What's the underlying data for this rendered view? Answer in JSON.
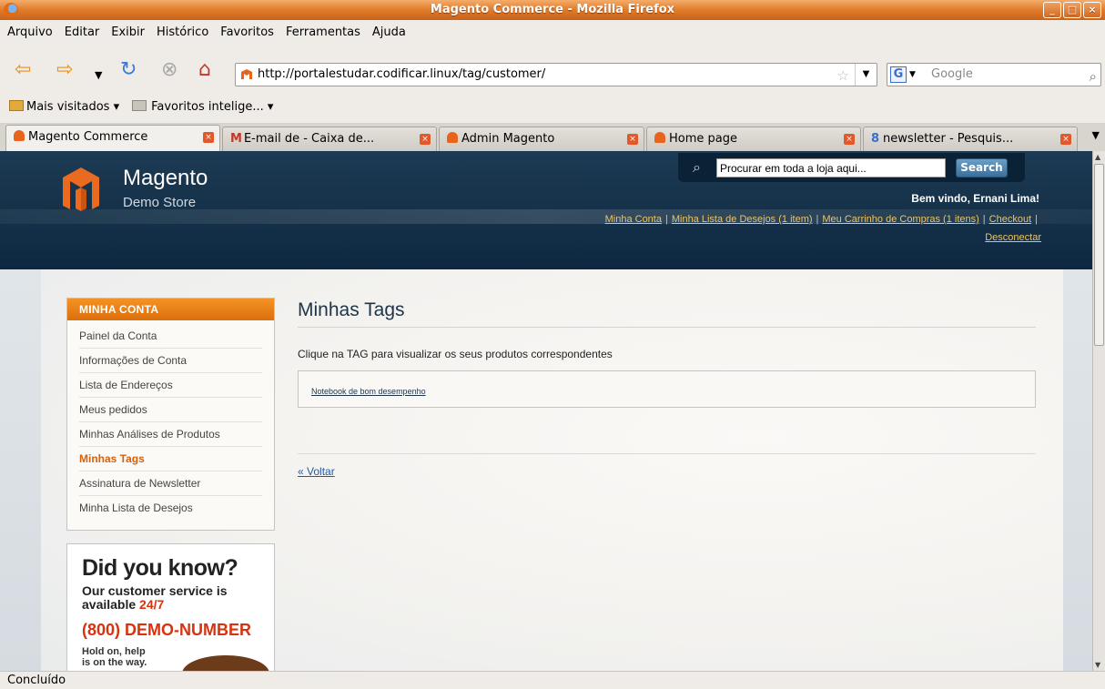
{
  "window": {
    "title": "Magento Commerce - Mozilla Firefox",
    "min_label": "_",
    "max_label": "□",
    "close_label": "×"
  },
  "menu": [
    "Arquivo",
    "Editar",
    "Exibir",
    "Histórico",
    "Favoritos",
    "Ferramentas",
    "Ajuda"
  ],
  "nav": {
    "url": "http://portalestudar.codificar.linux/tag/customer/",
    "search_placeholder": "Google"
  },
  "bookmarks": [
    "Mais visitados ▾",
    "Favoritos intelige... ▾"
  ],
  "tabs": [
    {
      "label": "Magento Commerce"
    },
    {
      "label": "E-mail de  - Caixa de..."
    },
    {
      "label": "Admin Magento"
    },
    {
      "label": "Home page"
    },
    {
      "label": "newsletter - Pesquis..."
    }
  ],
  "store": {
    "logo_name": "Magento",
    "logo_sub": "Demo Store",
    "search_placeholder": "Procurar em toda a loja aqui...",
    "search_button": "Search",
    "welcome": "Bem vindo, Ernani Lima!",
    "links": [
      "Minha Conta",
      "Minha Lista de Desejos (1 item)",
      "Meu Carrinho de Compras (1 itens)",
      "Checkout",
      "Desconectar"
    ]
  },
  "sidebar": {
    "title": "MINHA CONTA",
    "items": [
      "Painel da Conta",
      "Informações de Conta",
      "Lista de Endereços",
      "Meus pedidos",
      "Minhas Análises de Produtos",
      "Minhas Tags",
      "Assinatura de Newsletter",
      "Minha Lista de Desejos"
    ],
    "current_index": 5
  },
  "promo": {
    "headline": "Did you know?",
    "line1": "Our customer service is available ",
    "highlight": "24/7",
    "phone": "(800) DEMO-NUMBER",
    "note": "Hold on, help is on the way."
  },
  "content": {
    "title": "Minhas Tags",
    "intro": "Clique na TAG para visualizar os seus produtos correspondentes",
    "tag": "Notebook de bom desempenho",
    "back": "« Voltar"
  },
  "status": "Concluído"
}
